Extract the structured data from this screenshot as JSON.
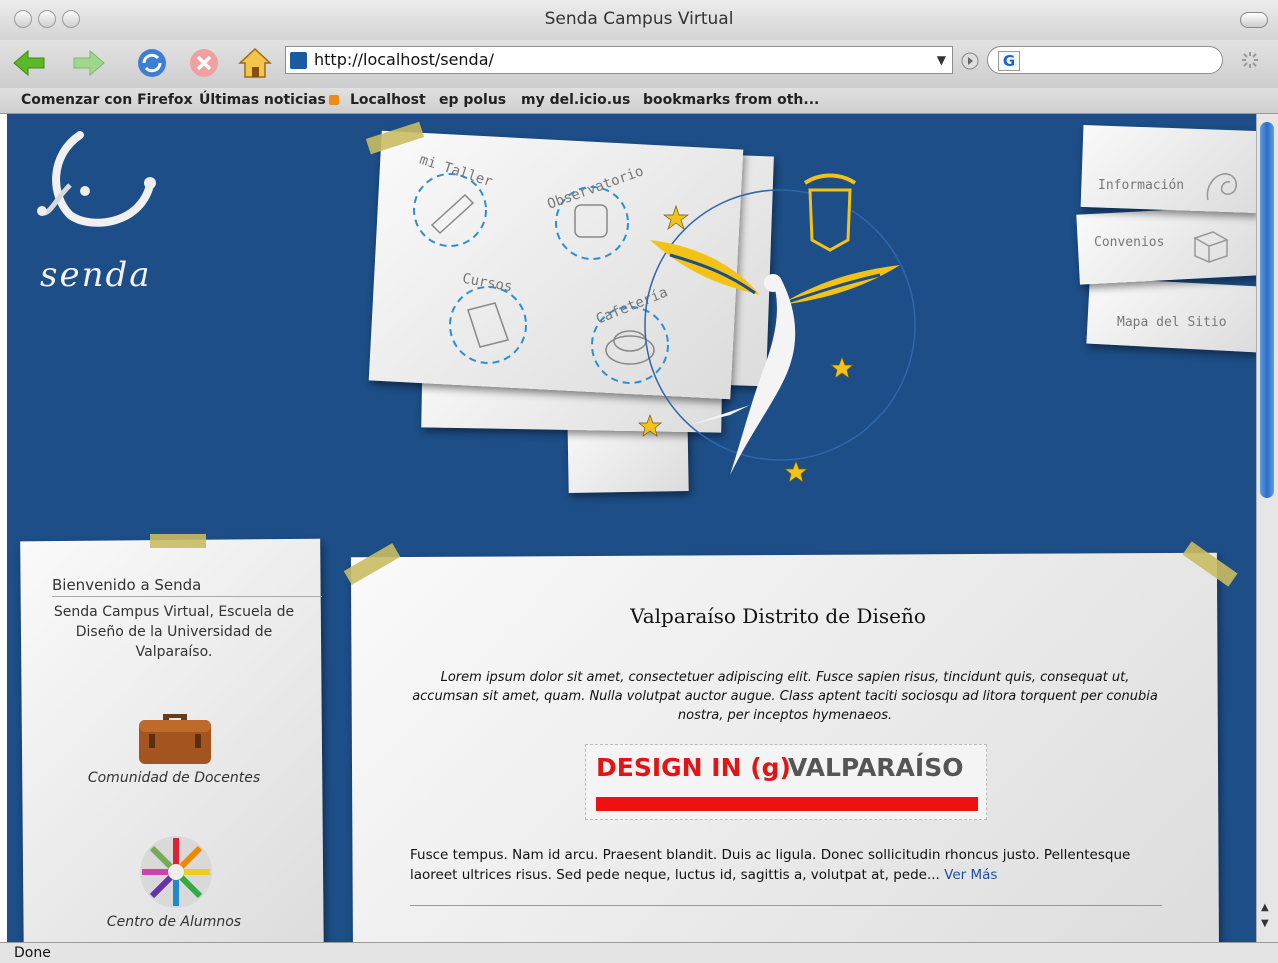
{
  "window": {
    "title": "Senda Campus Virtual"
  },
  "toolbar": {
    "url": "http://localhost/senda/"
  },
  "bookmarks": [
    {
      "label": "Comenzar con Firefox"
    },
    {
      "label": "Últimas noticias"
    },
    {
      "label": "Localhost"
    },
    {
      "label": "ep polus"
    },
    {
      "label": "my del.icio.us"
    },
    {
      "label": "bookmarks from oth..."
    }
  ],
  "header": {
    "logo_text": "senda",
    "scrap_items": [
      "mi Taller",
      "Observatorio",
      "Cursos",
      "Cafetería"
    ],
    "nav_tabs": [
      "Información",
      "Convenios",
      "Mapa del Sitio"
    ]
  },
  "left": {
    "title": "Bienvenido a Senda",
    "description": "Senda Campus Virtual, Escuela de Diseño de la Universidad de Valparaíso.",
    "links": [
      "Comunidad de Docentes",
      "Centro de Alumnos"
    ]
  },
  "main": {
    "title": "Valparaíso Distrito de Diseño",
    "intro": "Lorem ipsum dolor sit amet, consectetuer adipiscing elit. Fusce sapien risus, tincidunt quis, consequat ut, accumsan sit amet, quam. Nulla volutpat auctor augue. Class aptent taciti sociosqu ad litora torquent per conubia nostra, per inceptos hymenaeos.",
    "banner_red": "DESIGN IN (g)",
    "banner_gray": "VALPARAÍSO",
    "body": "Fusce tempus. Nam id arcu. Praesent blandit. Duis ac ligula. Donec sollicitudin rhoncus justo. Pellentesque laoreet ultrices risus. Sed pede neque, luctus id, sagittis a, volutpat at, pede...",
    "more_link": "Ver Más"
  },
  "status": {
    "text": "Done"
  },
  "colors": {
    "page_bg": "#1d4e87",
    "accent_yellow": "#f2c316",
    "banner_red": "#e01515"
  }
}
